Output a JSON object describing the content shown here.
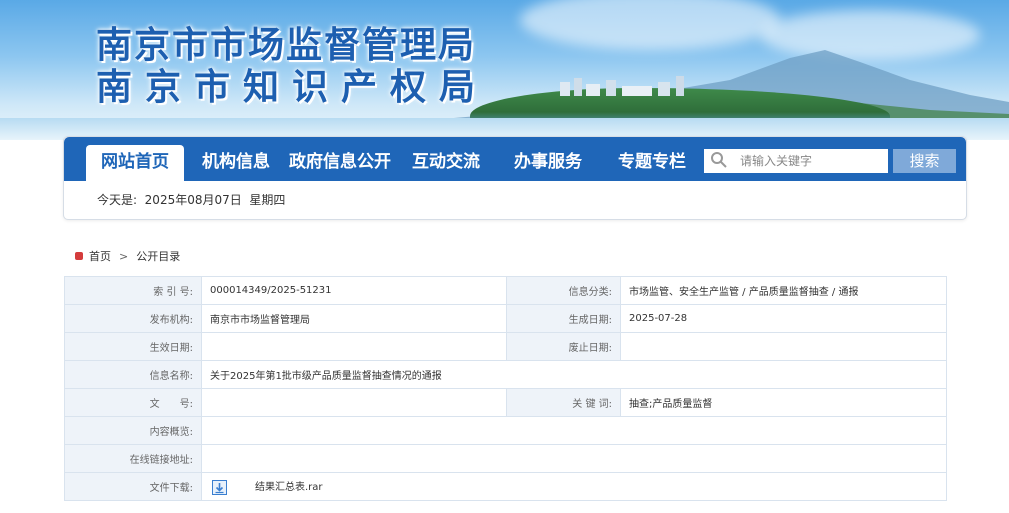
{
  "header": {
    "title_line1": "南京市市场监督管理局",
    "title_line2": "南京市知识产权局"
  },
  "nav": {
    "items": [
      {
        "label": "网站首页",
        "active": true
      },
      {
        "label": "机构信息",
        "active": false
      },
      {
        "label": "政府信息公开",
        "active": false
      },
      {
        "label": "互动交流",
        "active": false
      },
      {
        "label": "办事服务",
        "active": false
      },
      {
        "label": "专题专栏",
        "active": false
      }
    ],
    "search_placeholder": "请输入关键字",
    "search_button": "搜索",
    "today_text": "今天是:  2025年08月07日  星期四"
  },
  "breadcrumb": {
    "home": "首页",
    "separator": ">",
    "current": "公开目录"
  },
  "info": {
    "index_label": "索 引 号:",
    "index_value": "000014349/2025-51231",
    "category_label": "信息分类:",
    "category_value": "市场监管、安全生产监管 / 产品质量监督抽查 / 通报",
    "publisher_label": "发布机构:",
    "publisher_value": "南京市市场监督管理局",
    "created_label": "生成日期:",
    "created_value": "2025-07-28",
    "effective_label": "生效日期:",
    "effective_value": "",
    "repeal_label": "废止日期:",
    "repeal_value": "",
    "name_label": "信息名称:",
    "name_value": "关于2025年第1批市级产品质量监督抽查情况的通报",
    "docno_label": "文　　号:",
    "docno_value": "",
    "keywords_label": "关 键 词:",
    "keywords_value": "抽查;产品质量监督",
    "summary_label": "内容概览:",
    "summary_value": "",
    "link_label": "在线链接地址:",
    "link_value": "",
    "download_label": "文件下载:",
    "download_file": "结果汇总表.rar"
  },
  "colors": {
    "nav_blue": "#1f66b8",
    "title_blue": "#1d5fb0",
    "label_bg": "#eef3f9"
  }
}
